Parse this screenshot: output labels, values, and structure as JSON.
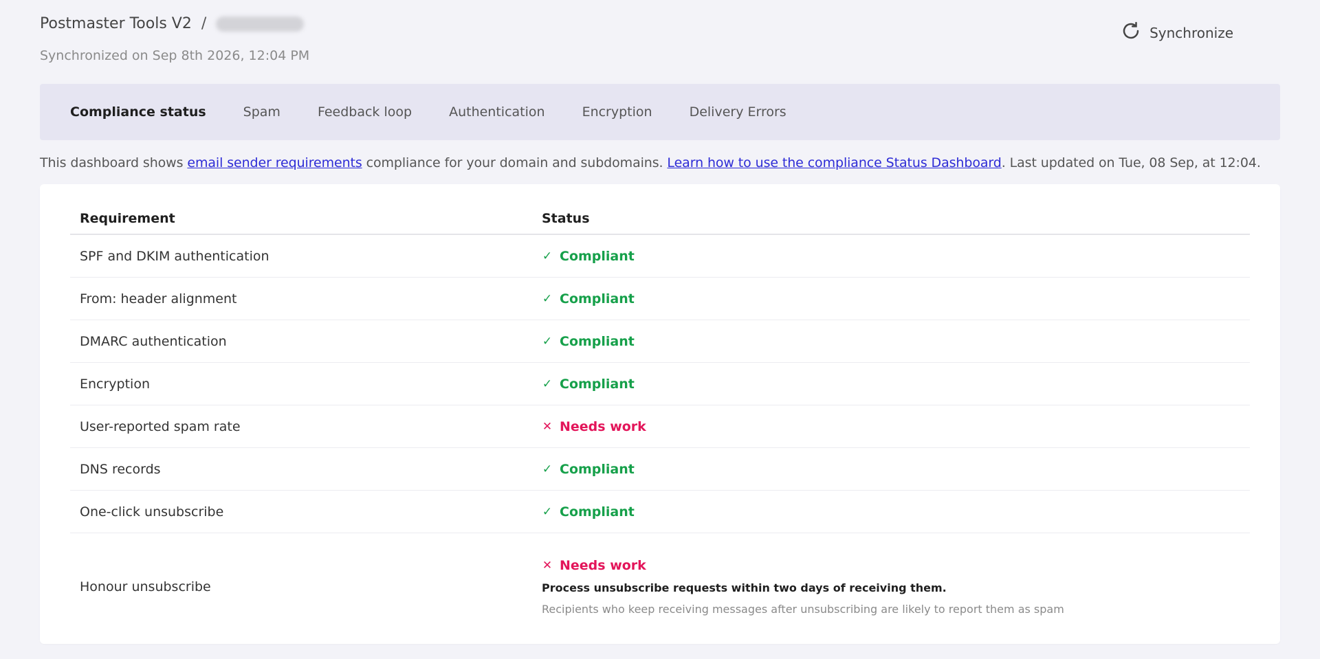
{
  "header": {
    "breadcrumb_root": "Postmaster Tools V2",
    "breadcrumb_separator": "/",
    "sync_info": "Synchronized on Sep 8th 2026, 12:04 PM",
    "sync_button_label": "Synchronize"
  },
  "tabs": [
    {
      "label": "Compliance status",
      "active": true
    },
    {
      "label": "Spam",
      "active": false
    },
    {
      "label": "Feedback loop",
      "active": false
    },
    {
      "label": "Authentication",
      "active": false
    },
    {
      "label": "Encryption",
      "active": false
    },
    {
      "label": "Delivery Errors",
      "active": false
    }
  ],
  "intro": {
    "prefix": "This dashboard shows ",
    "link1": "email sender requirements",
    "middle": " compliance for your domain and subdomains. ",
    "link2": "Learn how to use the compliance Status Dashboard",
    "suffix": ". Last updated on Tue, 08 Sep, at 12:04."
  },
  "table": {
    "headers": {
      "requirement": "Requirement",
      "status": "Status"
    },
    "rows": [
      {
        "requirement": "SPF and DKIM authentication",
        "status": "Compliant"
      },
      {
        "requirement": "From: header alignment",
        "status": "Compliant"
      },
      {
        "requirement": "DMARC authentication",
        "status": "Compliant"
      },
      {
        "requirement": "Encryption",
        "status": "Compliant"
      },
      {
        "requirement": "User-reported spam rate",
        "status": "Needs work"
      },
      {
        "requirement": "DNS records",
        "status": "Compliant"
      },
      {
        "requirement": "One-click unsubscribe",
        "status": "Compliant"
      },
      {
        "requirement": "Honour unsubscribe",
        "status": "Needs work",
        "detail_title": "Process unsubscribe requests within two days of receiving them.",
        "detail_note": "Recipients who keep receiving messages after unsubscribing are likely to report them as spam"
      }
    ]
  },
  "icons": {
    "compliant": "check-icon",
    "needs_work": "cross-icon",
    "sync": "refresh-icon"
  },
  "colors": {
    "compliant": "#16a04a",
    "needs_work": "#e3155a",
    "link": "#2d2bd6",
    "tab_bar": "#e6e5f2"
  }
}
